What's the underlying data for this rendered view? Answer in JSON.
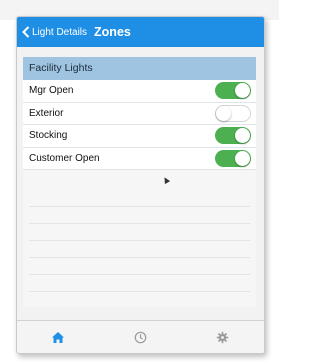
{
  "navbar": {
    "back_label": "Light Details",
    "title": "Zones",
    "color": "#1f8fe5"
  },
  "section": {
    "header": "Facility Lights",
    "rows": [
      {
        "label": "Mgr Open",
        "toggle": "on"
      },
      {
        "label": "Exterior",
        "toggle": "off"
      },
      {
        "label": "Stocking",
        "toggle": "on"
      },
      {
        "label": "Customer Open",
        "toggle": "on"
      }
    ]
  },
  "tabbar": {
    "tabs": [
      {
        "icon": "home-icon",
        "active": true,
        "color": "#1f8fe5"
      },
      {
        "icon": "clock-icon",
        "active": false,
        "color": "#9a9a9a"
      },
      {
        "icon": "gear-icon",
        "active": false,
        "color": "#9a9a9a"
      }
    ]
  },
  "colors": {
    "toggle_on": "#4cb050",
    "section_header_bg": "#9ec4e1"
  }
}
